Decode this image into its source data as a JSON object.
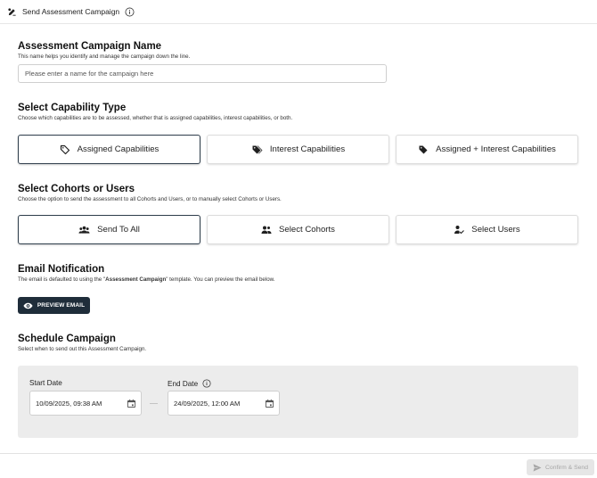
{
  "header": {
    "title": "Send Assessment Campaign"
  },
  "campaign_name": {
    "title": "Assessment Campaign Name",
    "description": "This name helps you identify and manage the campaign down the line.",
    "placeholder": "Please enter a name for the campaign here",
    "value": ""
  },
  "capability": {
    "title": "Select Capability Type",
    "description": "Choose which capabilities are to be assessed, whether that is assigned capabilities, interest capabilities, or both.",
    "options": [
      {
        "label": "Assigned Capabilities",
        "icon": "tag-outline-icon",
        "selected": true
      },
      {
        "label": "Interest Capabilities",
        "icon": "tags-icon",
        "selected": false
      },
      {
        "label": "Assigned + Interest Capabilities",
        "icon": "tag-filled-icon",
        "selected": false
      }
    ]
  },
  "cohorts": {
    "title": "Select Cohorts or Users",
    "description": "Choose the option to send the assessment to all Cohorts and Users, or to manually select Cohorts or Users.",
    "options": [
      {
        "label": "Send To All",
        "icon": "groups-icon",
        "selected": true
      },
      {
        "label": "Select Cohorts",
        "icon": "people-icon",
        "selected": false
      },
      {
        "label": "Select Users",
        "icon": "person-check-icon",
        "selected": false
      }
    ]
  },
  "email": {
    "title": "Email Notification",
    "description_before": "The email is defaulted to using the \"",
    "description_template": "Assessment Campaign",
    "description_after": "\" template. You can preview the email below.",
    "preview_label": "PREVIEW EMAIL"
  },
  "schedule": {
    "title": "Schedule Campaign",
    "description": "Select when to send out this Assessment Campaign.",
    "start_label": "Start Date",
    "start_value": "10/09/2025, 09:38 AM",
    "end_label": "End Date",
    "end_value": "24/09/2025, 12:00 AM"
  },
  "footer": {
    "confirm_label": "Confirm & Send",
    "confirm_disabled": true
  },
  "colors": {
    "primary_dark": "#1f2d3a",
    "selected_border": "#2f3e4c",
    "panel_bg": "#ececec",
    "disabled_text": "#a6a6a6"
  }
}
